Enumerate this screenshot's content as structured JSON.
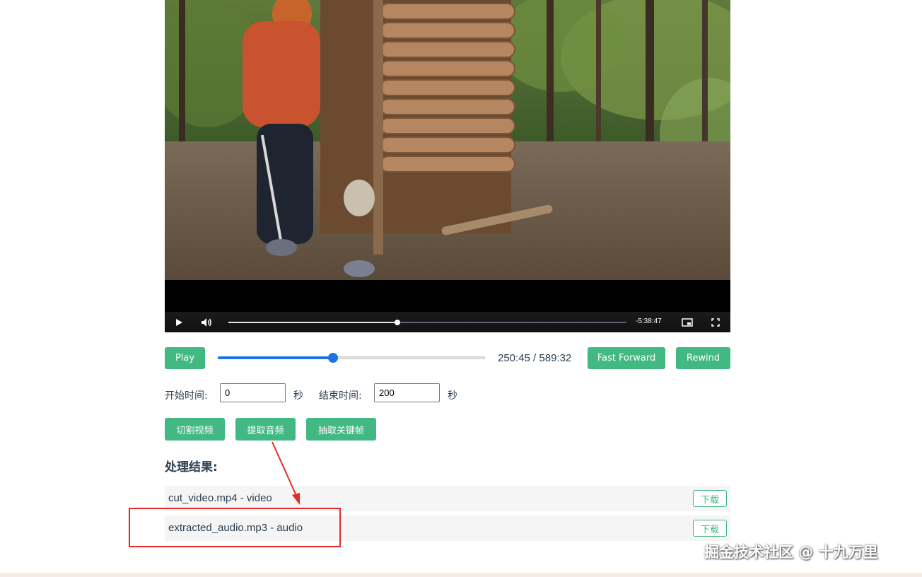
{
  "video": {
    "remaining_time": "-5:38:47",
    "progress_fraction": 0.425
  },
  "controls": {
    "play_label": "Play",
    "seek_fraction": 0.43,
    "time_display": "250:45 / 589:32",
    "fast_forward_label": "Fast Forward",
    "rewind_label": "Rewind"
  },
  "range": {
    "start_label": "开始时间:",
    "start_value": "0",
    "start_unit": "秒",
    "end_label": "结束时间:",
    "end_value": "200",
    "end_unit": "秒"
  },
  "actions": {
    "cut_label": "切割视频",
    "extract_audio_label": "提取音频",
    "keyframes_label": "抽取关键帧"
  },
  "results": {
    "title": "处理结果:",
    "items": [
      {
        "text": "cut_video.mp4 - video",
        "download_label": "下载"
      },
      {
        "text": "extracted_audio.mp3 - audio",
        "download_label": "下载"
      }
    ]
  },
  "colors": {
    "accent": "#42b883",
    "slider": "#1a73e8",
    "annotation": "#e32b2b"
  },
  "watermark": "掘金技术社区 @ 十九万里"
}
